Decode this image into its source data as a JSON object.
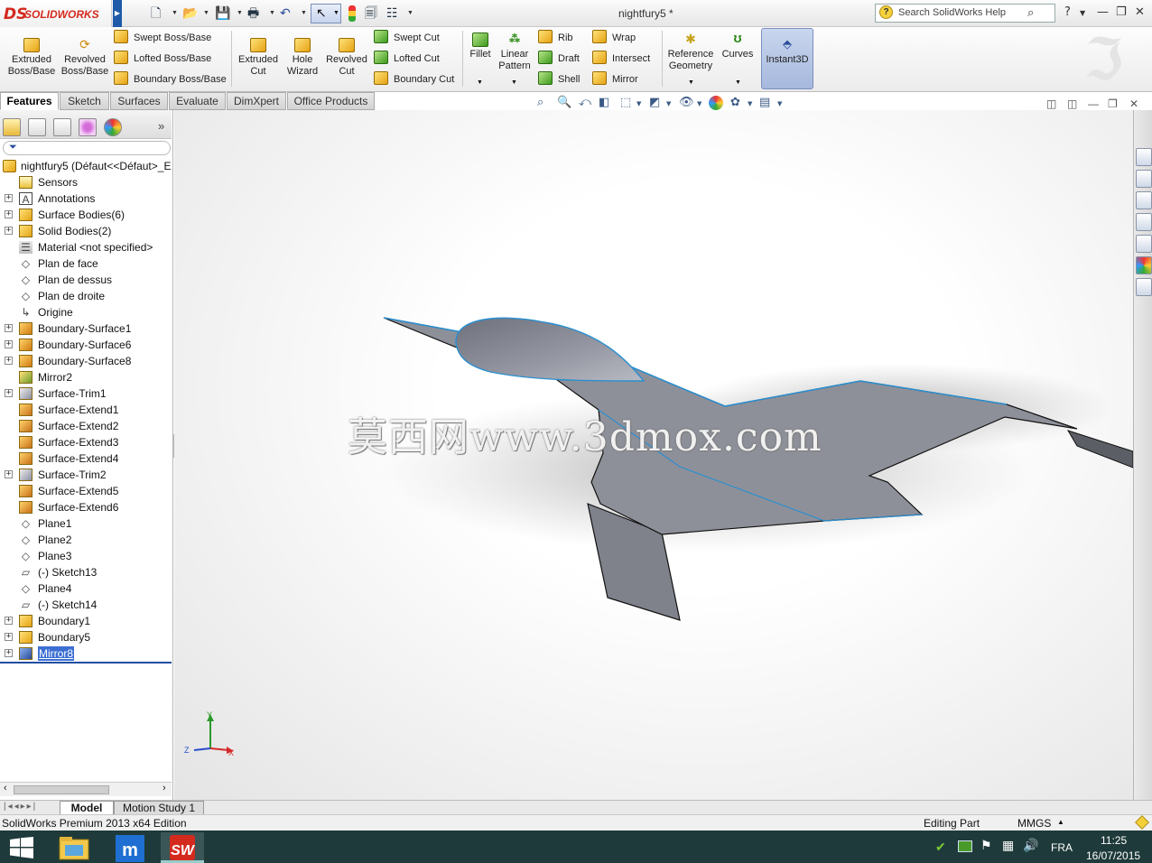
{
  "app": {
    "brand": "SOLIDWORKS",
    "brand_mark": "DS",
    "document_title": "nightfury5 *"
  },
  "help_search": {
    "placeholder": "Search SolidWorks Help"
  },
  "commands": {
    "extruded_boss": "Extruded Boss/Base",
    "revolved_boss": "Revolved Boss/Base",
    "swept_boss": "Swept Boss/Base",
    "lofted_boss": "Lofted Boss/Base",
    "boundary_boss": "Boundary Boss/Base",
    "extruded_cut": "Extruded Cut",
    "hole_wizard": "Hole Wizard",
    "revolved_cut": "Revolved Cut",
    "swept_cut": "Swept Cut",
    "lofted_cut": "Lofted Cut",
    "boundary_cut": "Boundary Cut",
    "fillet": "Fillet",
    "linear_pattern": "Linear Pattern",
    "rib": "Rib",
    "draft": "Draft",
    "shell": "Shell",
    "wrap": "Wrap",
    "intersect": "Intersect",
    "mirror": "Mirror",
    "reference_geometry": "Reference Geometry",
    "curves": "Curves",
    "instant3d": "Instant3D"
  },
  "tabs": [
    "Features",
    "Sketch",
    "Surfaces",
    "Evaluate",
    "DimXpert",
    "Office Products"
  ],
  "tree": {
    "root": "nightfury5  (Défaut<<Défaut>_E",
    "items": [
      {
        "label": "Sensors",
        "expandable": false,
        "icon": "sensor-icon"
      },
      {
        "label": "Annotations",
        "expandable": true,
        "icon": "annotation-icon"
      },
      {
        "label": "Surface Bodies(6)",
        "expandable": true,
        "icon": "surface-bodies-icon"
      },
      {
        "label": "Solid Bodies(2)",
        "expandable": true,
        "icon": "solid-bodies-icon"
      },
      {
        "label": "Material <not specified>",
        "expandable": false,
        "icon": "material-icon"
      },
      {
        "label": "Plan de face",
        "expandable": false,
        "icon": "plane-icon"
      },
      {
        "label": "Plan de dessus",
        "expandable": false,
        "icon": "plane-icon"
      },
      {
        "label": "Plan de droite",
        "expandable": false,
        "icon": "plane-icon"
      },
      {
        "label": "Origine",
        "expandable": false,
        "icon": "origin-icon"
      },
      {
        "label": "Boundary-Surface1",
        "expandable": true,
        "icon": "boundary-surface-icon"
      },
      {
        "label": "Boundary-Surface6",
        "expandable": true,
        "icon": "boundary-surface-icon"
      },
      {
        "label": "Boundary-Surface8",
        "expandable": true,
        "icon": "boundary-surface-icon"
      },
      {
        "label": "Mirror2",
        "expandable": false,
        "icon": "mirror-icon"
      },
      {
        "label": "Surface-Trim1",
        "expandable": true,
        "icon": "surface-trim-icon"
      },
      {
        "label": "Surface-Extend1",
        "expandable": false,
        "icon": "surface-extend-icon"
      },
      {
        "label": "Surface-Extend2",
        "expandable": false,
        "icon": "surface-extend-icon"
      },
      {
        "label": "Surface-Extend3",
        "expandable": false,
        "icon": "surface-extend-icon"
      },
      {
        "label": "Surface-Extend4",
        "expandable": false,
        "icon": "surface-extend-icon"
      },
      {
        "label": "Surface-Trim2",
        "expandable": true,
        "icon": "surface-trim-icon"
      },
      {
        "label": "Surface-Extend5",
        "expandable": false,
        "icon": "surface-extend-icon"
      },
      {
        "label": "Surface-Extend6",
        "expandable": false,
        "icon": "surface-extend-icon"
      },
      {
        "label": "Plane1",
        "expandable": false,
        "icon": "plane-icon"
      },
      {
        "label": "Plane2",
        "expandable": false,
        "icon": "plane-icon"
      },
      {
        "label": "Plane3",
        "expandable": false,
        "icon": "plane-icon"
      },
      {
        "label": "(-) Sketch13",
        "expandable": false,
        "icon": "sketch-icon"
      },
      {
        "label": "Plane4",
        "expandable": false,
        "icon": "plane-icon"
      },
      {
        "label": "(-) Sketch14",
        "expandable": false,
        "icon": "sketch-icon"
      },
      {
        "label": "Boundary1",
        "expandable": true,
        "icon": "boundary-icon"
      },
      {
        "label": "Boundary5",
        "expandable": true,
        "icon": "boundary-icon"
      },
      {
        "label": "Mirror8",
        "expandable": true,
        "icon": "mirror-body-icon",
        "selected": true
      }
    ]
  },
  "watermark": "莫西网www.3dmox.com",
  "triad": {
    "x": "X",
    "y": "Y",
    "z": "Z"
  },
  "model_tabs": {
    "model": "Model",
    "motion_study": "Motion Study 1"
  },
  "status": {
    "edition": "SolidWorks Premium 2013 x64 Edition",
    "mode": "Editing Part",
    "units": "MMGS"
  },
  "taskbar": {
    "language": "FRA",
    "time": "11:25",
    "date": "16/07/2015"
  },
  "colors": {
    "brand_red": "#d42a1e",
    "selection_blue": "#3c6fd3",
    "model_gray": "#8e9099",
    "edge_blue": "#2a8fd0"
  }
}
